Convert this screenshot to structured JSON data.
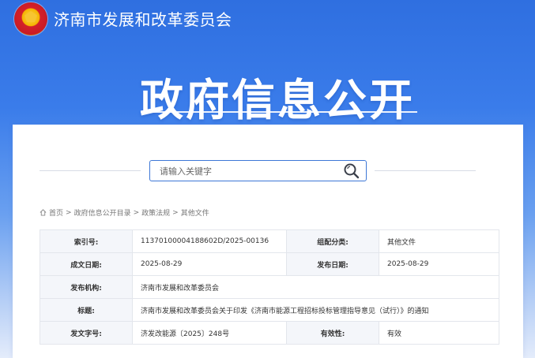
{
  "header": {
    "org_name": "济南市发展和改革委员会",
    "banner_title": "政府信息公开"
  },
  "search": {
    "placeholder": "请输入关键字"
  },
  "breadcrumb": {
    "items": [
      "首页",
      "政府信息公开目录",
      "政策法规",
      "其他文件"
    ],
    "separator": ">"
  },
  "meta_table": {
    "index_label": "索引号:",
    "index_value": "11370100004188602D/2025-00136",
    "category_label": "组配分类:",
    "category_value": "其他文件",
    "created_label": "成文日期:",
    "created_value": "2025-08-29",
    "published_label": "发布日期:",
    "published_value": "2025-08-29",
    "agency_label": "发布机构:",
    "agency_value": "济南市发展和改革委员会",
    "title_label": "标题:",
    "title_value": "济南市发展和改革委员会关于印发《济南市能源工程招标投标管理指导意见（试行）》的通知",
    "doc_no_label": "发文字号:",
    "doc_no_value": "济发改能源〔2025〕248号",
    "validity_label": "有效性:",
    "validity_value": "有效"
  },
  "colors": {
    "primary_blue": "#2f6fe0",
    "search_border": "#3d77d6",
    "table_label_bg": "#f4f6fa"
  }
}
